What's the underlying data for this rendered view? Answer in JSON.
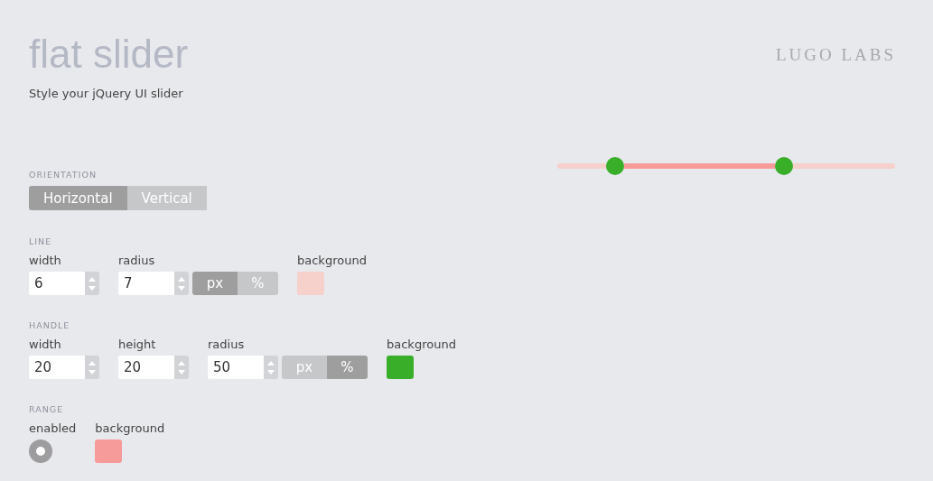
{
  "header": {
    "title": "flat slider",
    "subtitle": "Style your jQuery UI slider",
    "logo": "LUGO LABS"
  },
  "preview": {
    "handles": [
      {
        "level": 0.17
      },
      {
        "level": 0.67
      }
    ]
  },
  "orientation": {
    "label": "ORIENTATION",
    "options": [
      {
        "label": "Horizontal",
        "selected": true
      },
      {
        "label": "Vertical",
        "selected": false
      }
    ]
  },
  "sections": [
    {
      "label": "LINE",
      "controls": [
        {
          "kind": "number",
          "label": "width",
          "value": "6"
        },
        {
          "kind": "number",
          "label": "radius",
          "value": "7"
        },
        {
          "kind": "units",
          "options": [
            {
              "label": "px",
              "selected": true
            },
            {
              "label": "%",
              "selected": false
            }
          ]
        },
        {
          "kind": "color",
          "label": "background",
          "color": "#f6d0cb"
        }
      ]
    },
    {
      "label": "HANDLE",
      "controls": [
        {
          "kind": "number",
          "label": "width",
          "value": "20"
        },
        {
          "kind": "number",
          "label": "height",
          "value": "20"
        },
        {
          "kind": "number",
          "label": "radius",
          "value": "50"
        },
        {
          "kind": "units",
          "options": [
            {
              "label": "px",
              "selected": false
            },
            {
              "label": "%",
              "selected": true
            }
          ]
        },
        {
          "kind": "color",
          "label": "background",
          "color": "#38ae29"
        }
      ]
    },
    {
      "label": "RANGE",
      "controls": [
        {
          "kind": "radio",
          "label": "enabled",
          "checked": true
        },
        {
          "kind": "color",
          "label": "background",
          "color": "#f79a9a"
        }
      ]
    }
  ]
}
